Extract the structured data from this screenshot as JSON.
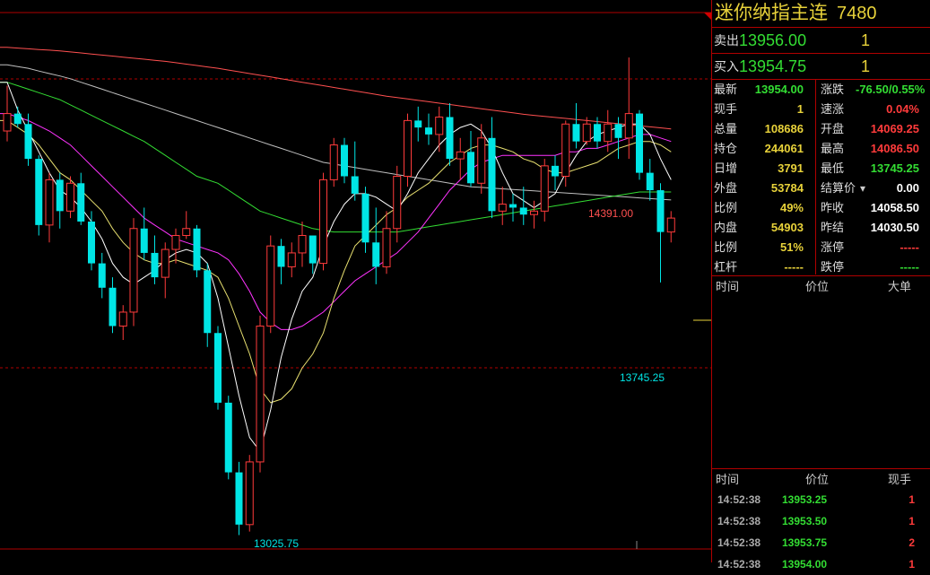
{
  "header": {
    "name": "迷你纳指主连",
    "code": "7480"
  },
  "quotes": {
    "ask": {
      "label": "卖出",
      "price": "13956.00",
      "volume": "1"
    },
    "bid": {
      "label": "买入",
      "price": "13954.75",
      "volume": "1"
    }
  },
  "stats": [
    {
      "l1": "最新",
      "v1": "13954.00",
      "c1": "g",
      "l2": "涨跌",
      "v2": "-76.50/0.55%",
      "c2": "g"
    },
    {
      "l1": "现手",
      "v1": "1",
      "c1": "y",
      "l2": "速涨",
      "v2": "0.04%",
      "c2": "r"
    },
    {
      "l1": "总量",
      "v1": "108686",
      "c1": "y",
      "l2": "开盘",
      "v2": "14069.25",
      "c2": "r"
    },
    {
      "l1": "持仓",
      "v1": "244061",
      "c1": "y",
      "l2": "最高",
      "v2": "14086.50",
      "c2": "r"
    },
    {
      "l1": "日增",
      "v1": "3791",
      "c1": "y",
      "l2": "最低",
      "v2": "13745.25",
      "c2": "g"
    },
    {
      "l1": "外盘",
      "v1": "53784",
      "c1": "y",
      "l2": "结算价",
      "v2": "0.00",
      "c2": "w"
    },
    {
      "l1": "比例",
      "v1": "49%",
      "c1": "y",
      "l2": "昨收",
      "v2": "14058.50",
      "c2": "w"
    },
    {
      "l1": "内盘",
      "v1": "54903",
      "c1": "y",
      "l2": "昨结",
      "v2": "14030.50",
      "c2": "w"
    },
    {
      "l1": "比例",
      "v1": "51%",
      "c1": "y",
      "l2": "涨停",
      "v2": "-----",
      "c2": "r"
    },
    {
      "l1": "杠杆",
      "v1": "-----",
      "c1": "y",
      "l2": "跌停",
      "v2": "-----",
      "c2": "g"
    }
  ],
  "bigorder_header": {
    "time": "时间",
    "price": "价位",
    "big": "大单"
  },
  "ticks_header": {
    "time": "时间",
    "price": "价位",
    "vol": "现手"
  },
  "ticks": [
    {
      "time": "14:52:38",
      "price": "13953.25",
      "vol": "1"
    },
    {
      "time": "14:52:38",
      "price": "13953.50",
      "vol": "1"
    },
    {
      "time": "14:52:38",
      "price": "13953.75",
      "vol": "2"
    },
    {
      "time": "14:52:38",
      "price": "13954.00",
      "vol": "1"
    }
  ],
  "chart_data": {
    "type": "candlestick",
    "ylim": [
      12980,
      14520
    ],
    "max_label": "14391.00",
    "min_label": "13745.25",
    "low_label": "13025.75",
    "colors": {
      "up": "#ff3b3b",
      "down": "#00e5e5",
      "ma5": "#ffffff",
      "ma10": "#e8e070",
      "ma20": "#ff33ff",
      "ma40": "#33dd33",
      "ma60": "#c0c0c0",
      "ma120": "#ff5050",
      "grid": "#b00000"
    },
    "candles": [
      [
        14180,
        14310,
        14150,
        14230
      ],
      [
        14230,
        14250,
        14190,
        14200
      ],
      [
        14200,
        14230,
        14080,
        14100
      ],
      [
        14100,
        14110,
        13880,
        13910
      ],
      [
        13910,
        14060,
        13860,
        14040
      ],
      [
        14040,
        14060,
        13900,
        13950
      ],
      [
        13950,
        14050,
        13930,
        14030
      ],
      [
        14030,
        14060,
        13910,
        13920
      ],
      [
        13920,
        13950,
        13780,
        13800
      ],
      [
        13800,
        13830,
        13700,
        13730
      ],
      [
        13730,
        13760,
        13600,
        13620
      ],
      [
        13620,
        13680,
        13580,
        13660
      ],
      [
        13660,
        13930,
        13620,
        13900
      ],
      [
        13900,
        13960,
        13810,
        13830
      ],
      [
        13830,
        13880,
        13740,
        13760
      ],
      [
        13760,
        13860,
        13700,
        13840
      ],
      [
        13840,
        13900,
        13800,
        13880
      ],
      [
        13880,
        13950,
        13870,
        13900
      ],
      [
        13900,
        13910,
        13760,
        13780
      ],
      [
        13780,
        13800,
        13560,
        13600
      ],
      [
        13600,
        13620,
        13380,
        13400
      ],
      [
        13400,
        13420,
        13180,
        13200
      ],
      [
        13200,
        13230,
        13020,
        13050
      ],
      [
        13050,
        13250,
        13030,
        13230
      ],
      [
        13230,
        13650,
        13200,
        13620
      ],
      [
        13620,
        13880,
        13600,
        13850
      ],
      [
        13850,
        13870,
        13740,
        13790
      ],
      [
        13790,
        13860,
        13760,
        13830
      ],
      [
        13830,
        13920,
        13790,
        13880
      ],
      [
        13880,
        13880,
        13770,
        13800
      ],
      [
        13800,
        14060,
        13780,
        14040
      ],
      [
        14040,
        14160,
        14020,
        14140
      ],
      [
        14140,
        14160,
        14030,
        14050
      ],
      [
        14050,
        14150,
        13980,
        14000
      ],
      [
        14000,
        14020,
        13830,
        13860
      ],
      [
        13860,
        13960,
        13740,
        13790
      ],
      [
        13790,
        13950,
        13770,
        13900
      ],
      [
        13900,
        14080,
        13860,
        14050
      ],
      [
        14050,
        14230,
        14020,
        14210
      ],
      [
        14210,
        14250,
        14150,
        14190
      ],
      [
        14190,
        14230,
        14140,
        14170
      ],
      [
        14170,
        14250,
        14120,
        14220
      ],
      [
        14220,
        14260,
        14080,
        14100
      ],
      [
        14100,
        14160,
        14040,
        14120
      ],
      [
        14120,
        14180,
        14020,
        14030
      ],
      [
        14030,
        14200,
        14000,
        14160
      ],
      [
        14160,
        14220,
        13930,
        13950
      ],
      [
        13950,
        14020,
        13910,
        13970
      ],
      [
        13970,
        14000,
        13920,
        13960
      ],
      [
        13960,
        14020,
        13910,
        13940
      ],
      [
        13940,
        13980,
        13900,
        13950
      ],
      [
        13950,
        14100,
        13920,
        14080
      ],
      [
        14080,
        14110,
        14010,
        14050
      ],
      [
        14050,
        14210,
        14020,
        14200
      ],
      [
        14200,
        14260,
        14130,
        14150
      ],
      [
        14150,
        14220,
        14140,
        14200
      ],
      [
        14200,
        14220,
        14130,
        14150
      ],
      [
        14150,
        14240,
        14120,
        14200
      ],
      [
        14200,
        14220,
        14100,
        14160
      ],
      [
        14160,
        14391,
        14100,
        14230
      ],
      [
        14230,
        14240,
        14040,
        14060
      ],
      [
        14060,
        14100,
        13980,
        14010
      ],
      [
        14010,
        14030,
        13745.25,
        13890
      ],
      [
        13890,
        13950,
        13860,
        13930
      ]
    ],
    "ma": {
      "ma5": [
        14320,
        14240,
        14180,
        14120,
        14060,
        14010,
        13990,
        13960,
        13920,
        13870,
        13800,
        13760,
        13740,
        13760,
        13780,
        13810,
        13830,
        13840,
        13830,
        13800,
        13700,
        13560,
        13420,
        13300,
        13260,
        13380,
        13530,
        13640,
        13720,
        13760,
        13850,
        13920,
        13970,
        14000,
        14000,
        13990,
        13970,
        13950,
        14000,
        14060,
        14100,
        14140,
        14170,
        14190,
        14200,
        14180,
        14130,
        14060,
        14000,
        13980,
        13960,
        13980,
        14000,
        14060,
        14110,
        14150,
        14170,
        14180,
        14190,
        14200,
        14200,
        14170,
        14100,
        14040
      ],
      "ma10": [
        14210,
        14190,
        14170,
        14140,
        14100,
        14060,
        14040,
        14010,
        13980,
        13950,
        13900,
        13860,
        13830,
        13810,
        13800,
        13800,
        13810,
        13800,
        13790,
        13780,
        13760,
        13700,
        13620,
        13540,
        13440,
        13400,
        13410,
        13440,
        13500,
        13540,
        13600,
        13700,
        13780,
        13850,
        13880,
        13910,
        13940,
        13960,
        13990,
        14010,
        14030,
        14060,
        14090,
        14110,
        14130,
        14140,
        14140,
        14130,
        14120,
        14100,
        14090,
        14070,
        14060,
        14060,
        14070,
        14080,
        14090,
        14110,
        14130,
        14140,
        14150,
        14150,
        14140,
        14120
      ],
      "ma20": [
        14230,
        14220,
        14210,
        14195,
        14180,
        14160,
        14140,
        14110,
        14080,
        14050,
        14020,
        13990,
        13960,
        13930,
        13910,
        13890,
        13870,
        13860,
        13850,
        13840,
        13830,
        13810,
        13770,
        13720,
        13660,
        13630,
        13610,
        13610,
        13620,
        13640,
        13660,
        13690,
        13720,
        13750,
        13770,
        13790,
        13810,
        13830,
        13860,
        13890,
        13930,
        13970,
        14010,
        14040,
        14070,
        14090,
        14100,
        14110,
        14110,
        14110,
        14110,
        14110,
        14110,
        14120,
        14120,
        14130,
        14130,
        14140,
        14150,
        14160,
        14170,
        14170,
        14160,
        14150
      ],
      "ma40": [
        14320,
        14310,
        14300,
        14290,
        14280,
        14270,
        14255,
        14240,
        14225,
        14210,
        14195,
        14180,
        14165,
        14150,
        14130,
        14110,
        14090,
        14070,
        14050,
        14040,
        14030,
        14010,
        13990,
        13970,
        13950,
        13940,
        13930,
        13920,
        13910,
        13900,
        13895,
        13890,
        13890,
        13890,
        13890,
        13890,
        13890,
        13890,
        13895,
        13900,
        13905,
        13910,
        13915,
        13920,
        13925,
        13930,
        13935,
        13940,
        13945,
        13950,
        13955,
        13960,
        13965,
        13970,
        13975,
        13980,
        13985,
        13990,
        13995,
        14000,
        14005,
        14005,
        14005,
        14005
      ],
      "ma60": [
        14370,
        14365,
        14360,
        14352,
        14345,
        14338,
        14330,
        14320,
        14310,
        14300,
        14290,
        14280,
        14270,
        14260,
        14250,
        14240,
        14230,
        14220,
        14210,
        14200,
        14190,
        14180,
        14170,
        14160,
        14150,
        14140,
        14130,
        14120,
        14110,
        14100,
        14090,
        14085,
        14080,
        14075,
        14070,
        14065,
        14060,
        14055,
        14050,
        14045,
        14040,
        14035,
        14030,
        14025,
        14020,
        14018,
        14016,
        14014,
        14012,
        14010,
        14008,
        14006,
        14004,
        14002,
        14000,
        13998,
        13996,
        13994,
        13992,
        13990,
        13988,
        13986,
        13984,
        13982
      ],
      "ma120": [
        14420,
        14418,
        14416,
        14414,
        14412,
        14410,
        14407,
        14404,
        14401,
        14398,
        14395,
        14392,
        14389,
        14386,
        14383,
        14380,
        14376,
        14372,
        14368,
        14364,
        14360,
        14355,
        14350,
        14345,
        14340,
        14335,
        14330,
        14325,
        14320,
        14315,
        14310,
        14305,
        14300,
        14295,
        14290,
        14285,
        14280,
        14276,
        14272,
        14268,
        14264,
        14260,
        14256,
        14252,
        14248,
        14244,
        14240,
        14236,
        14232,
        14228,
        14225,
        14222,
        14219,
        14216,
        14213,
        14210,
        14207,
        14204,
        14201,
        14198,
        14195,
        14192,
        14189,
        14186
      ]
    }
  }
}
